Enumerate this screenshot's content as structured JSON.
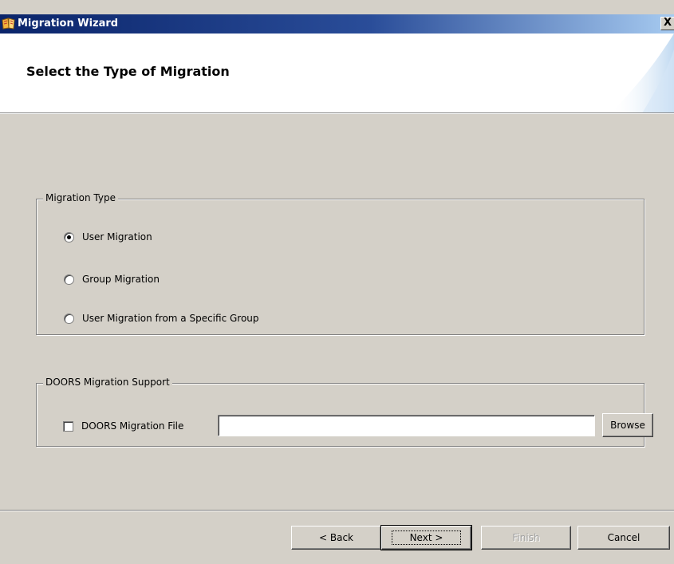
{
  "window": {
    "title": "Migration Wizard",
    "close_glyph": "X",
    "icon": "wizard-app-icon"
  },
  "header": {
    "title": "Select the Type of Migration"
  },
  "migration_type": {
    "legend": "Migration Type",
    "options": [
      {
        "label": "User Migration",
        "selected": true
      },
      {
        "label": "Group Migration",
        "selected": false
      },
      {
        "label": "User Migration from a Specific Group",
        "selected": false
      }
    ]
  },
  "doors": {
    "legend": "DOORS Migration Support",
    "checkbox_label": "DOORS Migration File",
    "checked": false,
    "file_value": "",
    "browse_label": "Browse"
  },
  "buttons": {
    "back": "< Back",
    "next": "Next >",
    "finish": "Finish",
    "cancel": "Cancel"
  },
  "colors": {
    "dialog_face": "#d4d0c8",
    "titlebar_start": "#0a246a",
    "titlebar_end": "#a6caf0",
    "header_bg": "#ffffff"
  }
}
